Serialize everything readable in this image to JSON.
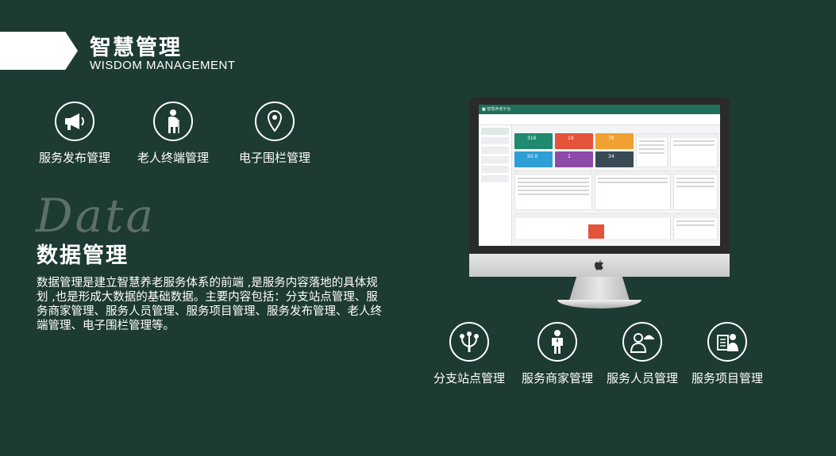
{
  "header": {
    "title": "智慧管理",
    "subtitle": "WISDOM MANAGEMENT"
  },
  "top_features": [
    {
      "label": "服务发布管理",
      "icon": "megaphone-icon"
    },
    {
      "label": "老人终端管理",
      "icon": "elderly-person-icon"
    },
    {
      "label": "电子围栏管理",
      "icon": "location-pin-icon"
    }
  ],
  "data_section": {
    "decor_word": "Data",
    "title": "数据管理",
    "description": "数据管理是建立智慧养老服务体系的前端 ,是服务内容落地的具体规划 ,也是形成大数据的基础数据。主要内容包括：分支站点管理、服务商家管理、服务人员管理、服务项目管理、服务发布管理、老人终端管理、电子围栏管理等。"
  },
  "bottom_features": [
    {
      "label": "分支站点管理",
      "icon": "branch-network-icon"
    },
    {
      "label": "服务商家管理",
      "icon": "merchant-person-icon"
    },
    {
      "label": "服务人员管理",
      "icon": "service-staff-icon"
    },
    {
      "label": "服务项目管理",
      "icon": "project-document-icon"
    }
  ],
  "dashboard": {
    "tiles": [
      {
        "value": "316",
        "color": "#1f8a6f"
      },
      {
        "value": "19",
        "color": "#e5533b"
      },
      {
        "value": "78",
        "color": "#f0a030"
      },
      {
        "value": "50.0",
        "color": "#2e9fd6"
      },
      {
        "value": "1",
        "color": "#8e4aa8"
      },
      {
        "value": "34",
        "color": "#3a4a55"
      }
    ]
  },
  "colors": {
    "background": "#1d3a33",
    "accent_green": "#1f6f5b"
  }
}
